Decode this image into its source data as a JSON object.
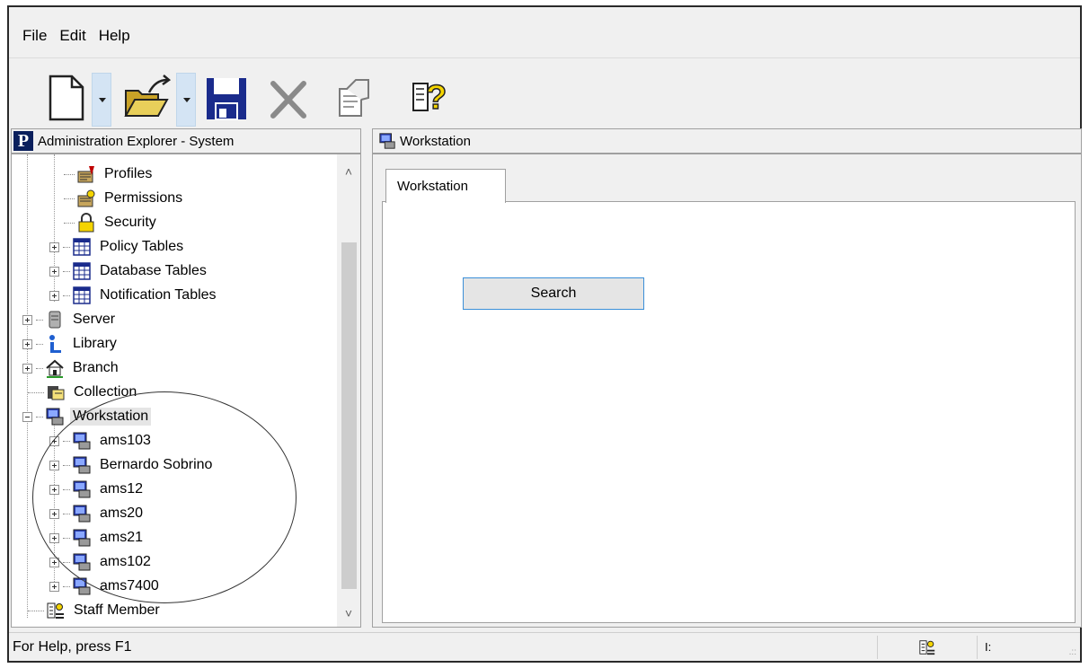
{
  "menu": {
    "items": [
      "File",
      "Edit",
      "Help"
    ]
  },
  "toolbar": {
    "buttons": [
      "new-document-icon",
      "open-folder-icon",
      "save-icon",
      "delete-icon",
      "properties-icon",
      "context-help-icon"
    ]
  },
  "left_pane": {
    "header": "Administration Explorer - System",
    "logo_letter": "P",
    "tree": [
      {
        "label": "Profiles",
        "icon": "profiles-icon"
      },
      {
        "label": "Permissions",
        "icon": "permissions-icon"
      },
      {
        "label": "Security",
        "icon": "lock-icon"
      },
      {
        "label": "Policy Tables",
        "icon": "table-icon"
      },
      {
        "label": "Database Tables",
        "icon": "table-icon"
      },
      {
        "label": "Notification Tables",
        "icon": "table-icon"
      },
      {
        "label": "Server",
        "icon": "server-icon"
      },
      {
        "label": "Library",
        "icon": "library-icon"
      },
      {
        "label": "Branch",
        "icon": "house-icon"
      },
      {
        "label": "Collection",
        "icon": "collection-icon"
      },
      {
        "label": "Workstation",
        "icon": "workstation-icon"
      },
      {
        "label": "ams103",
        "icon": "workstation-icon"
      },
      {
        "label": "Bernardo Sobrino",
        "icon": "workstation-icon"
      },
      {
        "label": "ams12",
        "icon": "workstation-icon"
      },
      {
        "label": "ams20",
        "icon": "workstation-icon"
      },
      {
        "label": "ams21",
        "icon": "workstation-icon"
      },
      {
        "label": "ams102",
        "icon": "workstation-icon"
      },
      {
        "label": "ams7400",
        "icon": "workstation-icon"
      },
      {
        "label": "Staff Member",
        "icon": "staff-member-icon"
      }
    ]
  },
  "right_pane": {
    "header": "Workstation",
    "tab_label": "Workstation",
    "search_button": "Search"
  },
  "statusbar": {
    "text": "For Help, press F1",
    "indicator": "I:"
  }
}
